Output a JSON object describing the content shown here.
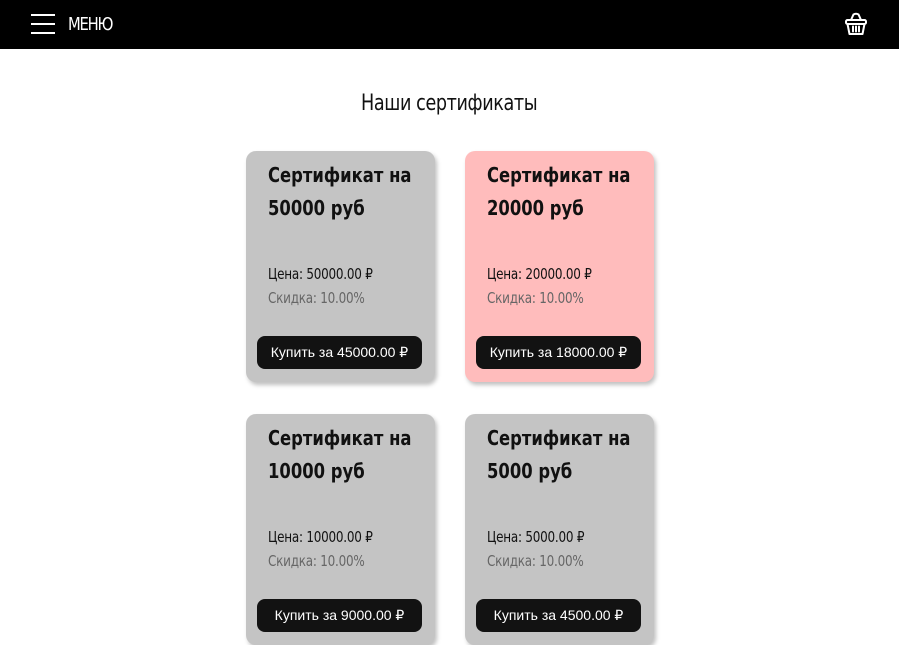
{
  "header": {
    "menu_label": "МЕНЮ",
    "menu_icon": "hamburger-icon",
    "cart_icon": "basket-icon",
    "background": "#000000"
  },
  "page": {
    "heading": "Наши сертификаты"
  },
  "cards": [
    {
      "title_line1": "Сертификат на",
      "title_line2": "50000 руб",
      "price": "Цена: 50000.00 ₽",
      "discount": "Скидка: 10.00%",
      "buy_label": "Купить за 45000.00 ₽",
      "background": "#c4c4c4"
    },
    {
      "title_line1": "Сертификат на",
      "title_line2": "20000 руб",
      "price": "Цена: 20000.00 ₽",
      "discount": "Скидка: 10.00%",
      "buy_label": "Купить за 18000.00 ₽",
      "background": "#ffbcbc"
    },
    {
      "title_line1": "Сертификат на",
      "title_line2": "10000 руб",
      "price": "Цена: 10000.00 ₽",
      "discount": "Скидка: 10.00%",
      "buy_label": "Купить за 9000.00 ₽",
      "background": "#c4c4c4"
    },
    {
      "title_line1": "Сертификат на",
      "title_line2": "5000 руб",
      "price": "Цена: 5000.00 ₽",
      "discount": "Скидка: 10.00%",
      "buy_label": "Купить за 4500.00 ₽",
      "background": "#c4c4c4"
    }
  ]
}
